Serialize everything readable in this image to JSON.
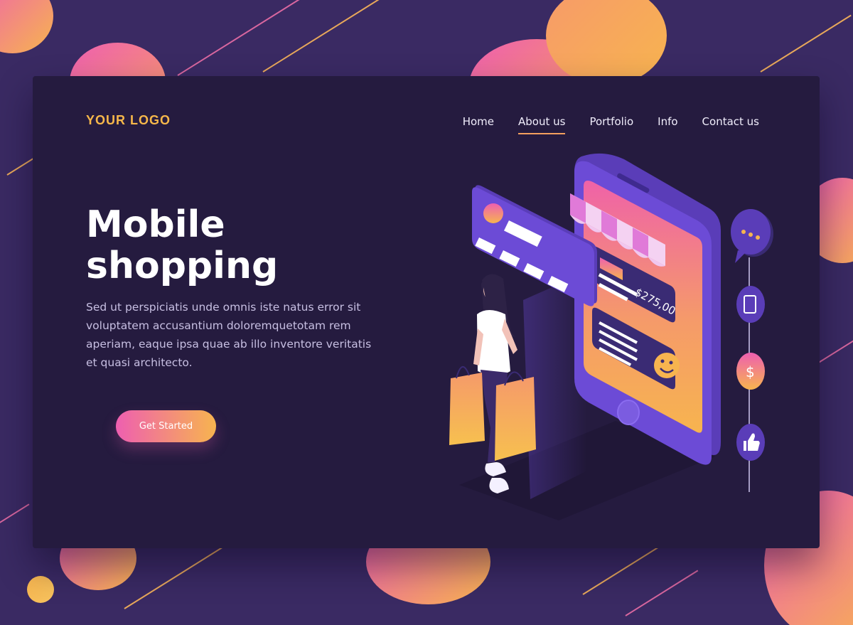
{
  "header": {
    "logo": "YOUR LOGO",
    "nav": [
      {
        "label": "Home",
        "active": false
      },
      {
        "label": "About us",
        "active": true
      },
      {
        "label": "Portfolio",
        "active": false
      },
      {
        "label": "Info",
        "active": false
      },
      {
        "label": "Contact us",
        "active": false
      }
    ]
  },
  "hero": {
    "title_line1": "Mobile",
    "title_line2": "shopping",
    "description": "Sed ut perspiciatis unde omnis iste natus error sit voluptatem accusantium doloremquetotam rem aperiam, eaque ipsa quae ab illo inventore veritatis et quasi architecto.",
    "cta_label": "Get Started"
  },
  "illustration": {
    "price": "$275,00",
    "icons": [
      "chat-icon",
      "tablet-icon",
      "dollar-icon",
      "thumbs-up-icon"
    ]
  },
  "colors": {
    "background": "#3a2a63",
    "card": "#251b3f",
    "logo": "#f7b84a",
    "accent_pink": "#ee5fb0",
    "accent_orange": "#f7b44f",
    "phone": "#6c4bd6"
  }
}
